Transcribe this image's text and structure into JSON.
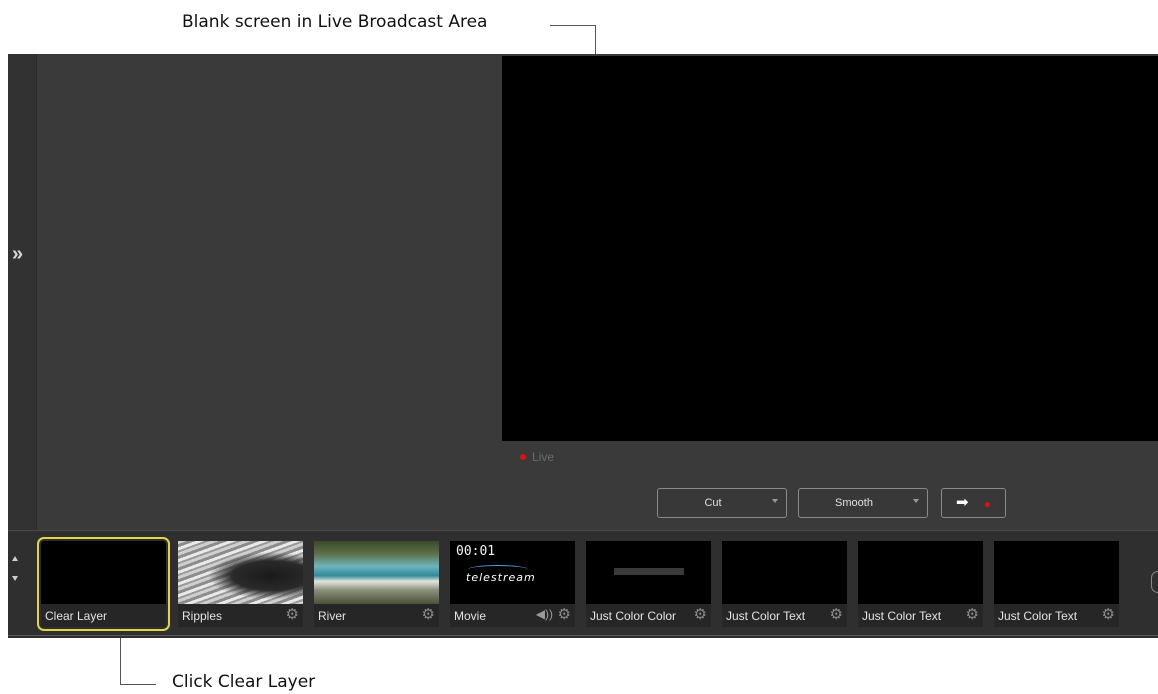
{
  "annotations": {
    "top": "Blank screen in Live Broadcast Area",
    "bottom": "Click Clear Layer"
  },
  "sidebar": {
    "expand_icon": "double-chevron-right-icon"
  },
  "preview": {
    "live_label": "Live",
    "live_color": "#e01010"
  },
  "controls": {
    "transition1": "Cut",
    "transition2": "Smooth",
    "go_icon": "arrow-right-icon"
  },
  "shots": [
    {
      "label": "Clear Layer",
      "selected": true
    },
    {
      "label": "Ripples"
    },
    {
      "label": "River"
    },
    {
      "label": "Movie",
      "timecode": "00:01",
      "logo": "telestream"
    },
    {
      "label": "Just Color Color"
    },
    {
      "label": "Just Color Text"
    },
    {
      "label": "Just Color Text"
    },
    {
      "label": "Just Color Text"
    }
  ],
  "colors": {
    "selection": "#e2d54a",
    "live_dot": "#e01010",
    "background": "#3a3a3a"
  }
}
